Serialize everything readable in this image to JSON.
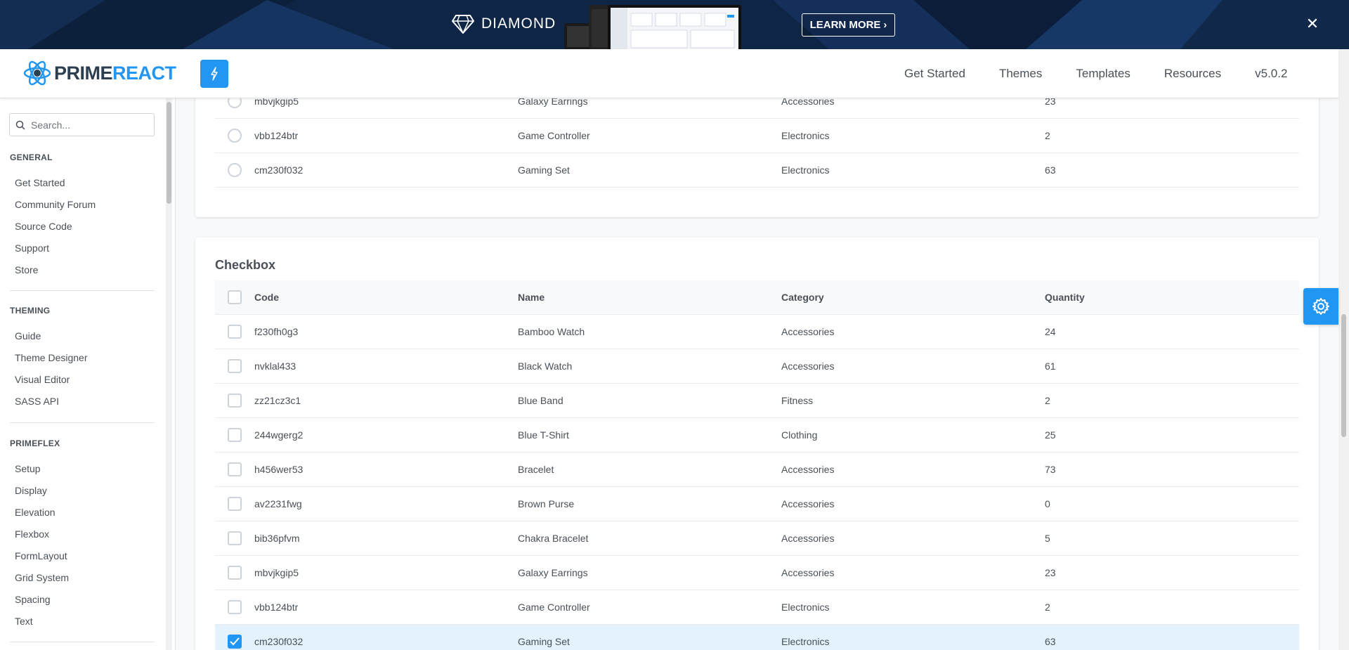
{
  "banner": {
    "brand": "DIAMOND",
    "cta_label": "LEARN MORE",
    "close_icon": "close-icon"
  },
  "topbar": {
    "logo_prime": "PRIME",
    "logo_react": "REACT",
    "nav": [
      {
        "label": "Get Started"
      },
      {
        "label": "Themes"
      },
      {
        "label": "Templates"
      },
      {
        "label": "Resources"
      },
      {
        "label": "v5.0.2"
      }
    ]
  },
  "sidebar": {
    "search_placeholder": "Search...",
    "sections": [
      {
        "title": "GENERAL",
        "items": [
          "Get Started",
          "Community Forum",
          "Source Code",
          "Support",
          "Store"
        ]
      },
      {
        "title": "THEMING",
        "items": [
          "Guide",
          "Theme Designer",
          "Visual Editor",
          "SASS API"
        ]
      },
      {
        "title": "PRIMEFLEX",
        "items": [
          "Setup",
          "Display",
          "Elevation",
          "Flexbox",
          "FormLayout",
          "Grid System",
          "Spacing",
          "Text"
        ]
      }
    ]
  },
  "radio_table": {
    "rows": [
      {
        "code": "mbvjkgip5",
        "name": "Galaxy Earrings",
        "category": "Accessories",
        "quantity": "23"
      },
      {
        "code": "vbb124btr",
        "name": "Game Controller",
        "category": "Electronics",
        "quantity": "2"
      },
      {
        "code": "cm230f032",
        "name": "Gaming Set",
        "category": "Electronics",
        "quantity": "63"
      }
    ]
  },
  "checkbox_table": {
    "title": "Checkbox",
    "columns": {
      "code": "Code",
      "name": "Name",
      "category": "Category",
      "quantity": "Quantity"
    },
    "rows": [
      {
        "code": "f230fh0g3",
        "name": "Bamboo Watch",
        "category": "Accessories",
        "quantity": "24",
        "checked": false
      },
      {
        "code": "nvklal433",
        "name": "Black Watch",
        "category": "Accessories",
        "quantity": "61",
        "checked": false
      },
      {
        "code": "zz21cz3c1",
        "name": "Blue Band",
        "category": "Fitness",
        "quantity": "2",
        "checked": false
      },
      {
        "code": "244wgerg2",
        "name": "Blue T-Shirt",
        "category": "Clothing",
        "quantity": "25",
        "checked": false
      },
      {
        "code": "h456wer53",
        "name": "Bracelet",
        "category": "Accessories",
        "quantity": "73",
        "checked": false
      },
      {
        "code": "av2231fwg",
        "name": "Brown Purse",
        "category": "Accessories",
        "quantity": "0",
        "checked": false
      },
      {
        "code": "bib36pfvm",
        "name": "Chakra Bracelet",
        "category": "Accessories",
        "quantity": "5",
        "checked": false
      },
      {
        "code": "mbvjkgip5",
        "name": "Galaxy Earrings",
        "category": "Accessories",
        "quantity": "23",
        "checked": false
      },
      {
        "code": "vbb124btr",
        "name": "Game Controller",
        "category": "Electronics",
        "quantity": "2",
        "checked": false
      },
      {
        "code": "cm230f032",
        "name": "Gaming Set",
        "category": "Electronics",
        "quantity": "63",
        "checked": true
      }
    ]
  },
  "colors": {
    "accent": "#2196f3",
    "banner_bg": "#0f2545",
    "selected_row": "#e3f2fd"
  }
}
